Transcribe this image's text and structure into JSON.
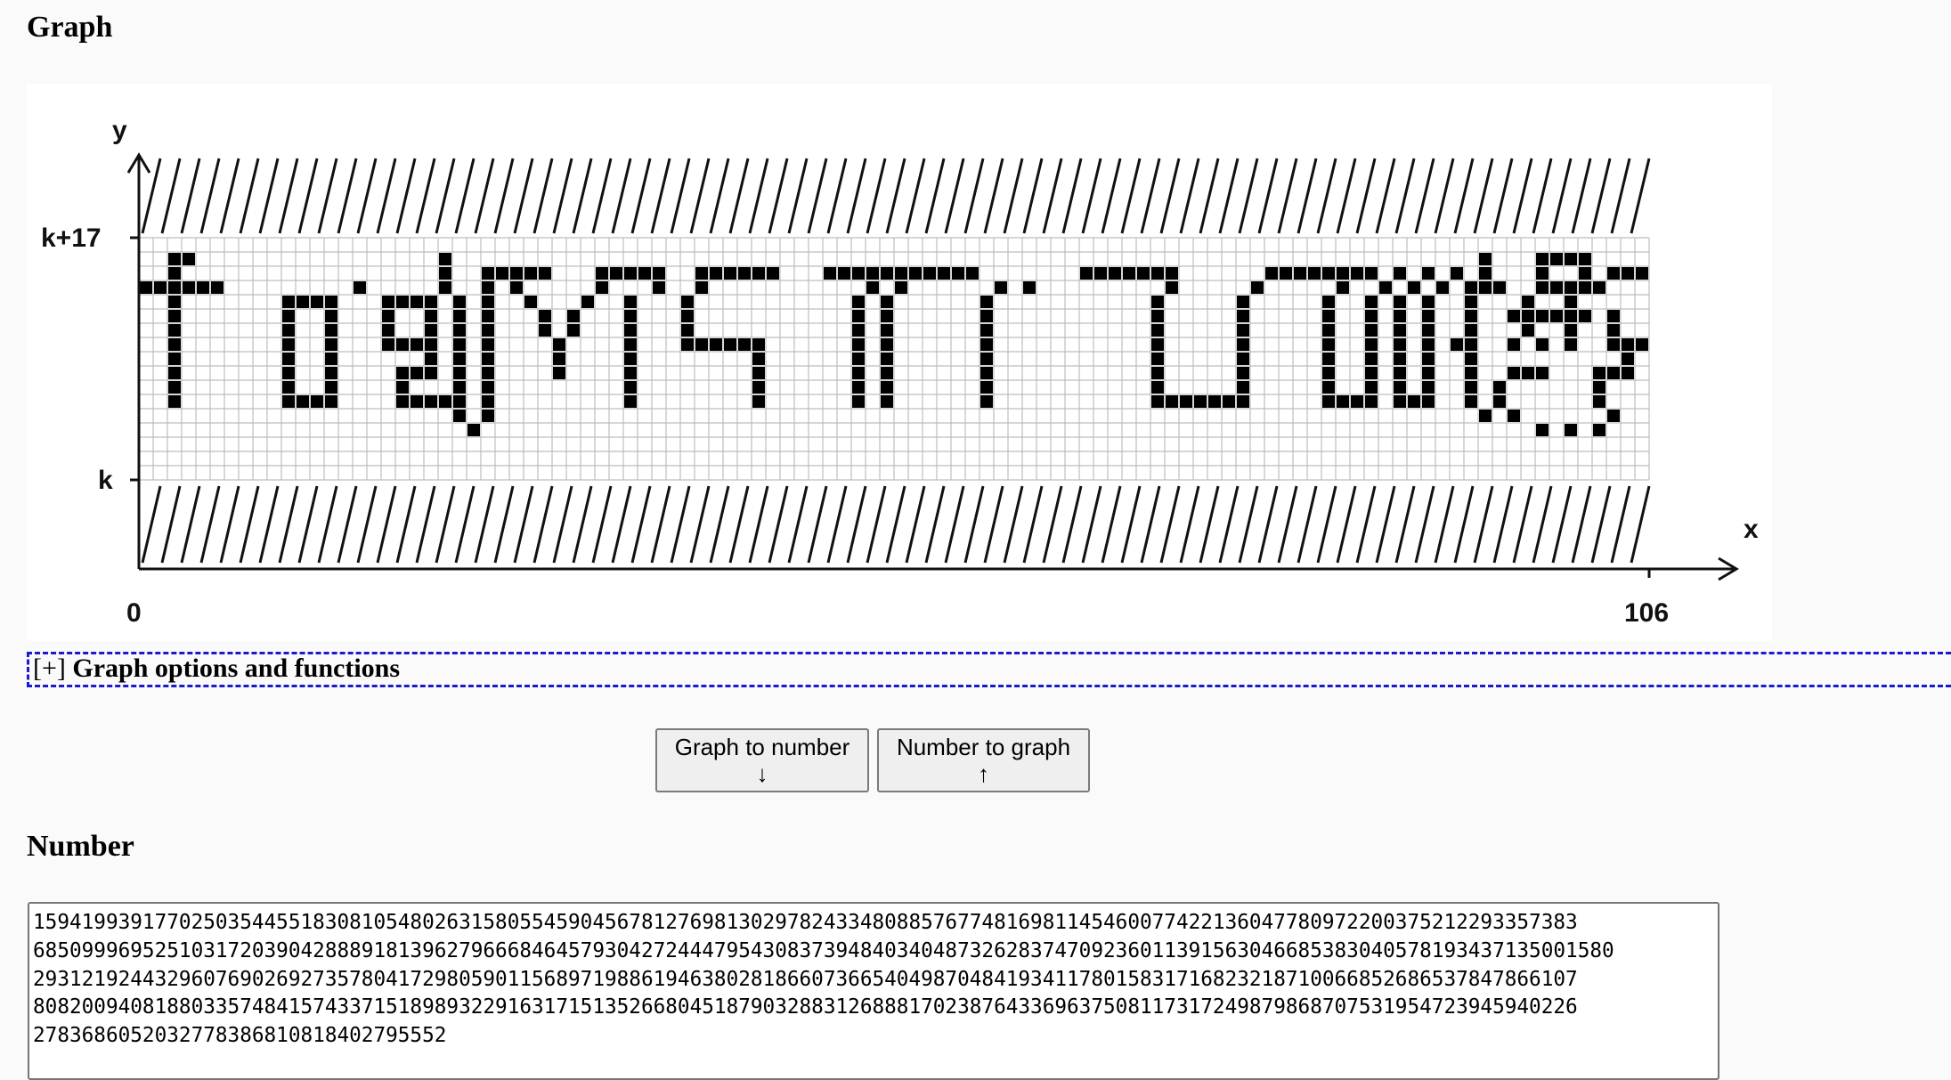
{
  "graph_heading": "Graph",
  "number_heading": "Number",
  "graph": {
    "axis_y_label": "y",
    "axis_x_label": "x",
    "y_top_tick": "k+17",
    "y_bottom_tick": "k",
    "x_start_tick": "0",
    "x_end_tick": "106",
    "grid_cols": 106,
    "grid_rows": 17,
    "pixel_rows": [
      "..................................................................................................................",
      "..##.................#........................................................................#...####......#.#....",
      "..#..................#..#####...#####..######...###########.......#######......########.#.#.#.#...#..#.#######...",
      "######.........#.....#..#.#.....#...#..#...........#.#......#.#.........#.....#.....#..#.#.#.###..#####...#.#....",
      "..#.......####...####.#.#..#...#..#...#...........#.#......#...........#.....#.....#..#.#.#..#...#..#.........#..",
      "..#.......#..#...#..#.#.#...#.#...#...#...........#.#......#...........#.....#.....#..#.#.#..#..######.#..#.#....",
      "..#.......#..#...#..#.#.#...#.#...#...#...........#.#......#...........#.....#.....#..#.#.#..#...#..#..#..#..#...",
      "..#.......#..#...####.#.#....#....#...######......#.#......#...........#.....#.....#..#.#.#.##..#.#.#..###..#.....",
      "..#.......#..#......#.#.#....#....#........#......#.#......#...........#.....#.....#..#.#.#..#..........#.#.#.....",
      "..#.......#..#....###.#.#....#....#........#......#.#......#...........#.....#.....#..#.#.#..#..###...###..###....",
      "..#.......#..#....#...#.#.........#........#......#.#......#...........#.....#.....#..#.#.#..#.#......#....#......",
      "..#.......####....#####.#.........#........#......#.#......#...........#######.....####.###..#.#......#....###....",
      "......................#.#.....................................................................#.#......#....#......",
      ".......................#..........................................................................#.#.#.....#......",
      "..................................................................................................................",
      "..................................................................................................................",
      ".................................................................................................................."
    ]
  },
  "options_toggle": "[+]",
  "options_label": "Graph options and functions",
  "buttons": {
    "graph_to_number_label": "Graph to number",
    "graph_to_number_arrow": "↓",
    "number_to_graph_label": "Number to graph",
    "number_to_graph_arrow": "↑"
  },
  "number_value": "1594199391770250354455183081054802631580554590456781276981302978243348088576774816981145460077422136047780972200375212293357383 6850999695251031720390428889181396279666846457930427244479543083739484034048732628374709236011391563046685383040578193437135001580 2931219244329607690269273578041729805901156897198861946380281866073665404987048419341178015831716823218710066852686537847866107 8082009408188033574841574337151898932291631715135266804518790328831268881702387643369637508117317249879868707531954723945940226 2783686052032778386810818402795552",
  "colors": {
    "options_border": "#1a1ad0",
    "button_bg": "#efefef"
  }
}
